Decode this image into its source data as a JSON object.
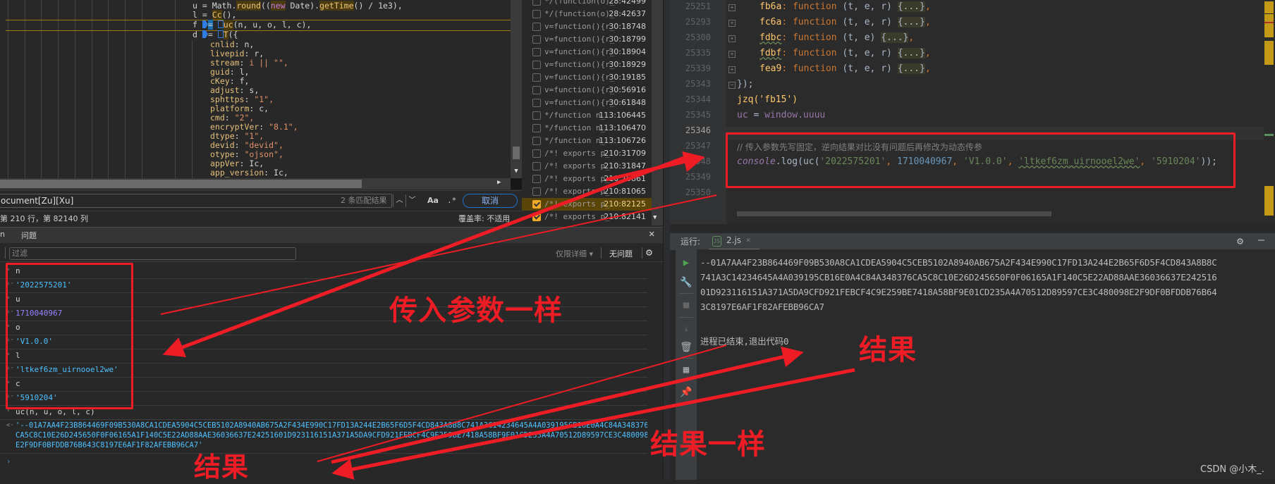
{
  "devtools": {
    "source_lines": [
      {
        "var": "u",
        "text": "u = Math.round((new Date).getTime() / 1e3),"
      },
      {
        "var": "l",
        "text": "l = Cc(),"
      },
      {
        "var": "f",
        "text": "f = uc(n, u, o, l, c),"
      },
      {
        "var": "d",
        "text": "d = T({"
      }
    ],
    "object_props": [
      {
        "key": "cnlid",
        "value": "n,"
      },
      {
        "key": "livepid",
        "value": "r,"
      },
      {
        "key": "stream",
        "value": "i || \"\","
      },
      {
        "key": "guid",
        "value": "l,"
      },
      {
        "key": "cKey",
        "value": "f,"
      },
      {
        "key": "adjust",
        "value": "s,"
      },
      {
        "key": "sphttps",
        "value": "\"1\","
      },
      {
        "key": "platform",
        "value": "c,"
      },
      {
        "key": "cmd",
        "value": "\"2\","
      },
      {
        "key": "encryptVer",
        "value": "\"8.1\","
      },
      {
        "key": "dtype",
        "value": "\"1\","
      },
      {
        "key": "devid",
        "value": "\"devid\","
      },
      {
        "key": "otype",
        "value": "\"ojson\","
      },
      {
        "key": "appVer",
        "value": "Ic,"
      },
      {
        "key": "app_version",
        "value": "Ic,"
      }
    ],
    "search": {
      "value": "ocument[Zu][Xu]",
      "match_count": "2 条匹配结果",
      "case_label": "Aa",
      "regex_label": ".*",
      "cancel_label": "取消"
    },
    "status": {
      "position": "第 210 行，第 82140 列",
      "coverage": "覆盖率: 不适用"
    },
    "breakpoints": [
      {
        "code": "*/(function(o)_",
        "location": "28:42499",
        "checked": false
      },
      {
        "code": "*/(function(o)_",
        "location": "28:42637",
        "checked": false
      },
      {
        "code": "v=function(){r_",
        "location": "30:18748",
        "checked": false
      },
      {
        "code": "v=function(){r_",
        "location": "30:18799",
        "checked": false
      },
      {
        "code": "v=function(){r_",
        "location": "30:18904",
        "checked": false
      },
      {
        "code": "v=function(){r_",
        "location": "30:18929",
        "checked": false
      },
      {
        "code": "v=function(){r_",
        "location": "30:19185",
        "checked": false
      },
      {
        "code": "v=function(){r_",
        "location": "30:56916",
        "checked": false
      },
      {
        "code": "v=function(){r_",
        "location": "30:61848",
        "checked": false
      },
      {
        "code": "*/function n_",
        "location": "113:106445",
        "checked": false
      },
      {
        "code": "*/function n_",
        "location": "113:106470",
        "checked": false
      },
      {
        "code": "*/function n_",
        "location": "113:106726",
        "checked": false
      },
      {
        "code": "/*! exports p_",
        "location": "210:31709",
        "checked": false
      },
      {
        "code": "/*! exports p_",
        "location": "210:31847",
        "checked": false
      },
      {
        "code": "/*! exports p_",
        "location": "210:75861",
        "checked": false
      },
      {
        "code": "/*! exports p_",
        "location": "210:81065",
        "checked": false
      },
      {
        "code": "/*! exports p_",
        "location": "210:82125",
        "checked": true,
        "active": true
      },
      {
        "code": "/*! exports p_",
        "location": "210:82141",
        "checked": true
      }
    ],
    "console": {
      "tabs": [
        "n",
        "问题"
      ],
      "filter_placeholder": "过滤",
      "levels_label": "仅限详细 ▾",
      "issues_label": "无问题",
      "entries": [
        {
          "type": "input",
          "text": "n"
        },
        {
          "type": "output-str",
          "text": "'2022575201'"
        },
        {
          "type": "input",
          "text": "u"
        },
        {
          "type": "output-num",
          "text": "1710040967"
        },
        {
          "type": "input",
          "text": "o"
        },
        {
          "type": "output-str",
          "text": "'V1.0.0'"
        },
        {
          "type": "input",
          "text": "l"
        },
        {
          "type": "output-str",
          "text": "'ltkef6zm_uirnooel2we'"
        },
        {
          "type": "input",
          "text": "c"
        },
        {
          "type": "output-str",
          "text": "'5910204'"
        },
        {
          "type": "input",
          "text": "uc(n, u, o, l, c)"
        }
      ],
      "result": "'--01A7AA4F23B864469F09B530A8CA1CDEA5904C5CEB5102A8940AB675A2F434E990C17FD13A244E2B65F6D5F4CD843A8B8C741A3C14234645A4A039195CB16E0A4C84A348376CA5C8C10E26D245650F0F06165A1F140C5E22AD88AAE36036637E24251601D923116151A371A5DA9CFD921FEBCF4C9E259BE7418A58BF9E01CD235A4A70512D89597CE3C480098E2F9DF0BFDDB76B643C8197E6AF1F82AFEBB96CA7'",
      "prompt": "›"
    }
  },
  "ide": {
    "lines": [
      {
        "num": "25251",
        "key": "fb6a",
        "params": "(t, e, r)",
        "folded": true
      },
      {
        "num": "25293",
        "key": "fc6a",
        "params": "(t, e, r)",
        "folded": true
      },
      {
        "num": "25300",
        "key": "fdbc",
        "params": "(t, e)",
        "folded": true
      },
      {
        "num": "25335",
        "key": "fdbf",
        "params": "(t, e, r)",
        "folded": true
      },
      {
        "num": "25339",
        "key": "fea9",
        "params": "(t, e, r)",
        "folded": true
      }
    ],
    "line_numbers_rest": [
      "25343",
      "25344",
      "25345",
      "25346",
      "25347",
      "25348",
      "25349",
      "25350"
    ],
    "closing": "});",
    "jzq_call": "jzq('fb15')",
    "uc_assign": {
      "lhs": "uc",
      "op": " = ",
      "obj": "window",
      "prop": ".uuuu"
    },
    "comment": "// 传入参数先写固定，逆向结果对比没有问题后再修改为动态传参",
    "console_call": {
      "console": "console",
      "log": ".log(",
      "fn": "uc(",
      "arg1": "'2022575201'",
      "arg2": "1710040967",
      "arg3": "'V1.0.0'",
      "arg4": "'ltkef6zm_uirnooel2we'",
      "arg5": "'5910204'",
      "close": "));"
    },
    "keyword_function": "function",
    "fold_placeholder": "{...}",
    "run": {
      "label": "运行:",
      "tab": "2.js",
      "output_lines": [
        "--01A7AA4F23B864469F09B530A8CA1CDEA5904C5CEB5102A8940AB675A2F434E990C17FD13A244E2B65F6D5F4CD843A8B8C",
        "741A3C14234645A4A039195CB16E0A4C84A348376CA5C8C10E26D245650F0F06165A1F140C5E22AD88AAE36036637E242516",
        "01D923116151A371A5DA9CFD921FEBCF4C9E259BE7418A58BF9E01CD235A4A70512D89597CE3C480098E2F9DF0BFDDB76B64",
        "3C8197E6AF1F82AFEBB96CA7"
      ],
      "exit_message": "进程已结束,退出代码0"
    }
  },
  "annotations": {
    "same_params": "传入参数一样",
    "result_left": "结果",
    "result_right": "结果",
    "same_result": "结果一样",
    "color": "#ee1c25"
  },
  "watermark": "CSDN @小木_."
}
